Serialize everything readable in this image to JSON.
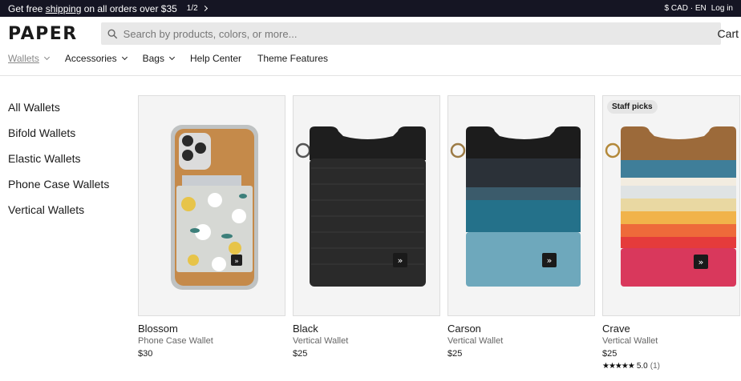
{
  "announcement": {
    "text_pre": "Get free ",
    "text_link": "shipping",
    "text_post": " on all orders over $35",
    "pager": "1/2",
    "currency": "$ CAD · EN",
    "login": "Log in"
  },
  "header": {
    "logo": "PAPER",
    "search_placeholder": "Search by products, colors, or more...",
    "cart": "Cart"
  },
  "nav": [
    {
      "label": "Wallets",
      "dropdown": true,
      "active": true
    },
    {
      "label": "Accessories",
      "dropdown": true
    },
    {
      "label": "Bags",
      "dropdown": true
    },
    {
      "label": "Help Center"
    },
    {
      "label": "Theme Features"
    }
  ],
  "sidebar": [
    "All Wallets",
    "Bifold Wallets",
    "Elastic Wallets",
    "Phone Case Wallets",
    "Vertical Wallets"
  ],
  "products": [
    {
      "name": "Blossom",
      "type": "Phone Case Wallet",
      "price": "$30",
      "badge": "",
      "rating": "",
      "reviews": ""
    },
    {
      "name": "Black",
      "type": "Vertical Wallet",
      "price": "$25",
      "badge": "",
      "rating": "",
      "reviews": ""
    },
    {
      "name": "Carson",
      "type": "Vertical Wallet",
      "price": "$25",
      "badge": "",
      "rating": "",
      "reviews": ""
    },
    {
      "name": "Crave",
      "type": "Vertical Wallet",
      "price": "$25",
      "badge": "Staff picks",
      "rating": "5.0",
      "reviews": "(1)",
      "stars": "★★★★★"
    }
  ],
  "colors": {
    "announce_bg": "#151523",
    "search_bg": "#e8e8e8",
    "card_bg": "#f4f4f4"
  }
}
